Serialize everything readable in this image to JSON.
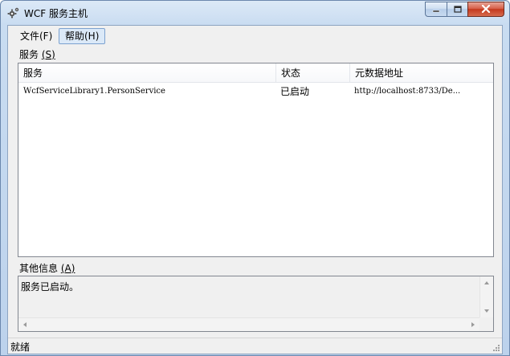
{
  "window": {
    "title": "WCF 服务主机",
    "title_icon": "gear-icon",
    "controls": [
      "minimize-icon",
      "maximize-icon",
      "close-icon"
    ]
  },
  "menu": {
    "file": "文件(F)",
    "help": "帮助(H)"
  },
  "services": {
    "label_text": "服务 ",
    "label_key": "S",
    "columns": [
      "服务",
      "状态",
      "元数据地址"
    ],
    "rows": [
      {
        "service": "WcfServiceLibrary1.PersonService",
        "status": "已启动",
        "metadata": "http://localhost:8733/De..."
      }
    ]
  },
  "info": {
    "label_text": "其他信息 ",
    "label_key": "A",
    "text": "服务已启动。"
  },
  "status": {
    "text": "就绪"
  },
  "colors": {
    "menu_highlight": "#dbe9f8",
    "close_button": "#c4391e"
  }
}
